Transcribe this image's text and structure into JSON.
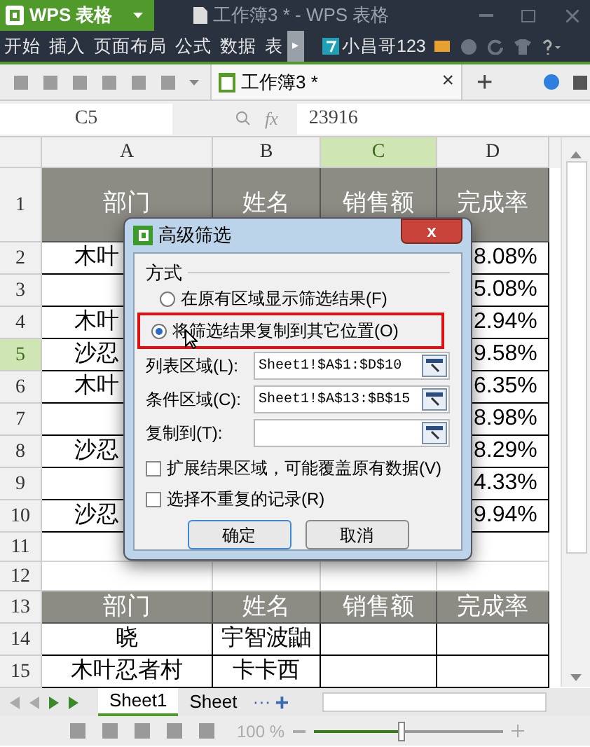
{
  "title_bar": {
    "app": "WPS 表格",
    "document": "工作簿3 * - WPS 表格"
  },
  "menu": {
    "items": [
      "开始",
      "插入",
      "页面布局",
      "公式",
      "数据",
      "表"
    ],
    "more": "▸",
    "user": "小昌哥123"
  },
  "toolbar": {
    "tab": "工作簿3 *",
    "close": "×",
    "add": "+"
  },
  "formula_bar": {
    "name_box": "C5",
    "fx": "fx",
    "value": "23916"
  },
  "columns": [
    {
      "label": "A",
      "selected": false
    },
    {
      "label": "B",
      "selected": false
    },
    {
      "label": "C",
      "selected": true
    },
    {
      "label": "D",
      "selected": false
    }
  ],
  "rows": [
    {
      "num": "1",
      "selected": false,
      "kind": "header",
      "cells": [
        "部门",
        "姓名",
        "销售额",
        "完成率"
      ]
    },
    {
      "num": "2",
      "selected": false,
      "kind": "partial",
      "a": "木叶",
      "d": "8.08%"
    },
    {
      "num": "3",
      "selected": false,
      "kind": "partial",
      "d": "5.08%"
    },
    {
      "num": "4",
      "selected": false,
      "kind": "partial",
      "a": "木叶",
      "d": "2.94%"
    },
    {
      "num": "5",
      "selected": true,
      "kind": "partial",
      "a": "沙忍",
      "d": "9.58%"
    },
    {
      "num": "6",
      "selected": false,
      "kind": "partial",
      "a": "木叶",
      "d": "6.35%"
    },
    {
      "num": "7",
      "selected": false,
      "kind": "partial",
      "d": "8.98%"
    },
    {
      "num": "8",
      "selected": false,
      "kind": "partial",
      "a": "沙忍",
      "d": "8.29%"
    },
    {
      "num": "9",
      "selected": false,
      "kind": "partial",
      "d": "4.33%"
    },
    {
      "num": "10",
      "selected": false,
      "kind": "partial",
      "a": "沙忍",
      "d": "9.94%"
    },
    {
      "num": "11",
      "selected": false,
      "kind": "empty"
    },
    {
      "num": "12",
      "selected": false,
      "kind": "empty"
    },
    {
      "num": "13",
      "selected": false,
      "kind": "header2",
      "cells": [
        "部门",
        "姓名",
        "销售额",
        "完成率"
      ]
    },
    {
      "num": "14",
      "selected": false,
      "kind": "data",
      "cells": [
        "晓",
        "宇智波鼬"
      ]
    },
    {
      "num": "15",
      "selected": false,
      "kind": "data",
      "cells": [
        "木叶忍者村",
        "卡卡西"
      ]
    }
  ],
  "dialog": {
    "title": "高级筛选",
    "close": "x",
    "group": "方式",
    "radios": [
      {
        "label": "在原有区域显示筛选结果(F)",
        "selected": false
      },
      {
        "label": "将筛选结果复制到其它位置(O)",
        "selected": true
      }
    ],
    "fields": [
      {
        "label": "列表区域(L):",
        "value": "Sheet1!$A$1:$D$10"
      },
      {
        "label": "条件区域(C):",
        "value": "Sheet1!$A$13:$B$15"
      },
      {
        "label": "复制到(T):"
      }
    ],
    "checkboxes": [
      {
        "label": "扩展结果区域，可能覆盖原有数据(V)",
        "checked": false
      },
      {
        "label": "选择不重复的记录(R)",
        "checked": false
      }
    ],
    "buttons": [
      "确定",
      "取消"
    ]
  },
  "sheet_tabs": [
    {
      "label": "Sheet1",
      "selected": true
    },
    {
      "label": "Sheet",
      "selected": false
    }
  ],
  "sheet_more": "···",
  "sheet_add": "+",
  "status_bar": {
    "zoom": "100 %",
    "zoom_slider": {
      "level": 0.46
    }
  }
}
